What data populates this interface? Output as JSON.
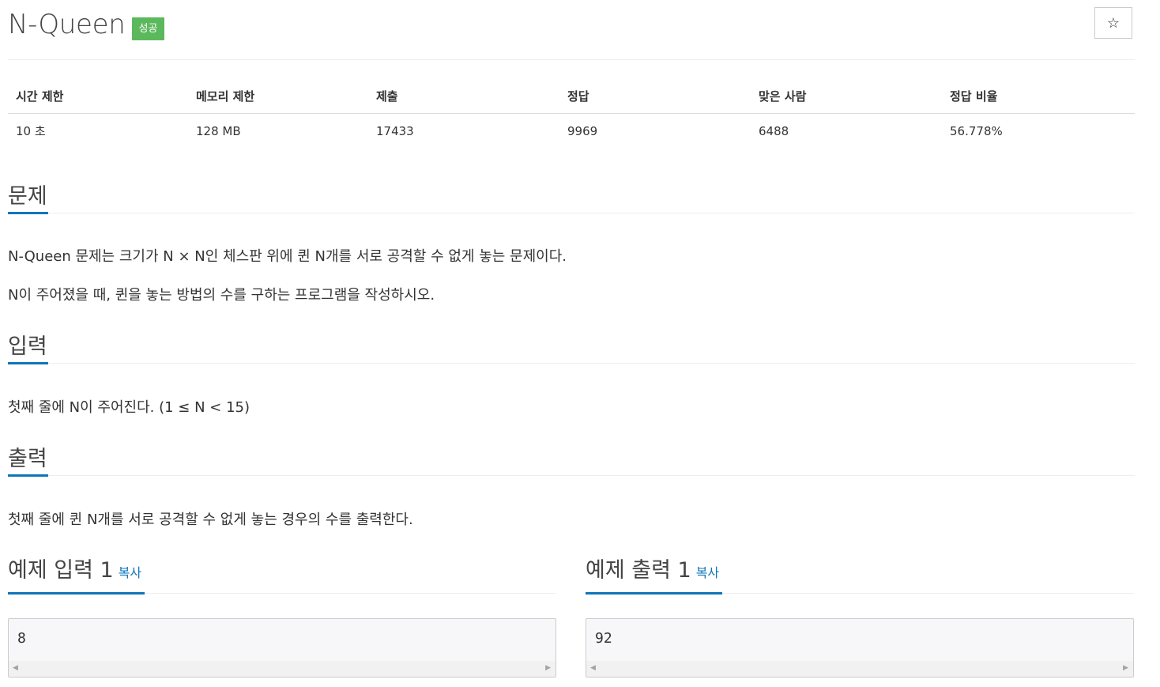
{
  "problem": {
    "title": "N-Queen",
    "status_badge": "성공",
    "star_icon": "☆"
  },
  "info": {
    "headers": [
      "시간 제한",
      "메모리 제한",
      "제출",
      "정답",
      "맞은 사람",
      "정답 비율"
    ],
    "values": [
      "10 초",
      "128 MB",
      "17433",
      "9969",
      "6488",
      "56.778%"
    ]
  },
  "sections": {
    "description": {
      "title": "문제",
      "lines": [
        "N-Queen 문제는 크기가 N × N인 체스판 위에 퀸 N개를 서로 공격할 수 없게 놓는 문제이다.",
        "N이 주어졌을 때, 퀸을 놓는 방법의 수를 구하는 프로그램을 작성하시오."
      ]
    },
    "input": {
      "title": "입력",
      "text": "첫째 줄에 N이 주어진다. (1 ≤ N < 15)"
    },
    "output": {
      "title": "출력",
      "text": "첫째 줄에 퀸 N개를 서로 공격할 수 없게 놓는 경우의 수를 출력한다."
    }
  },
  "samples": [
    {
      "title": "예제 입력 1",
      "copy_label": "복사",
      "content": "8"
    },
    {
      "title": "예제 출력 1",
      "copy_label": "복사",
      "content": "92"
    }
  ],
  "scroll_arrows": {
    "left": "◀",
    "right": "▶"
  },
  "colors": {
    "success_badge": "#5cb85c",
    "accent_blue": "#0e76b8",
    "pre_background": "#f7f7f9"
  }
}
